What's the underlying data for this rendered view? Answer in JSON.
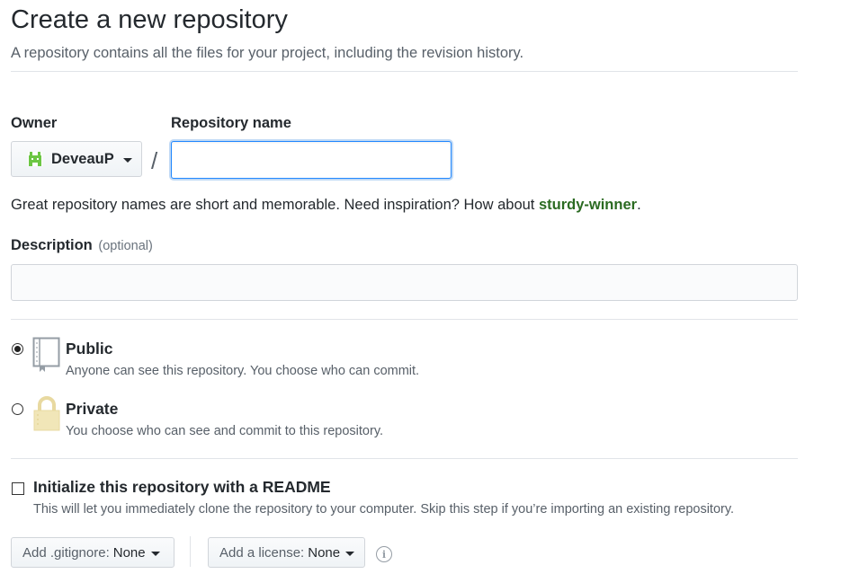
{
  "header": {
    "title": "Create a new repository",
    "subtitle": "A repository contains all the files for your project, including the revision history."
  },
  "owner": {
    "label": "Owner",
    "name": "DeveauP",
    "avatar_color": "#6cc644"
  },
  "slash": "/",
  "repository": {
    "label": "Repository name",
    "value": "",
    "placeholder": ""
  },
  "hint": {
    "text": "Great repository names are short and memorable. Need inspiration? How about ",
    "suggestion": "sturdy-winner",
    "end": "."
  },
  "description": {
    "label": "Description",
    "optional": "(optional)",
    "value": "",
    "placeholder": ""
  },
  "visibility": {
    "public": {
      "title": "Public",
      "desc": "Anyone can see this repository. You choose who can commit.",
      "selected": true
    },
    "private": {
      "title": "Private",
      "desc": "You choose who can see and commit to this repository.",
      "selected": false
    }
  },
  "readme": {
    "title": "Initialize this repository with a README",
    "desc": "This will let you immediately clone the repository to your computer. Skip this step if you’re importing an existing repository.",
    "checked": false
  },
  "gitignore": {
    "prefix": "Add .gitignore:",
    "value": "None"
  },
  "license": {
    "prefix": "Add a license:",
    "value": "None"
  },
  "colors": {
    "accent_blue": "#2188ff",
    "suggestion_green": "#2b6b22",
    "private_lock": "#e8d9a0"
  }
}
